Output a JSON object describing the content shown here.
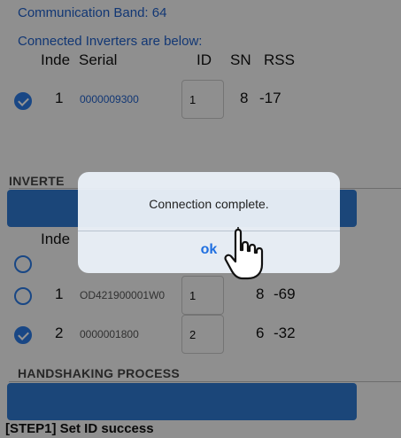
{
  "header": {
    "band_label": "Communication Band:",
    "band_value": "64",
    "connected_title": "Connected Inverters are below:"
  },
  "table_headers": {
    "index": "Inde",
    "serial": "Serial",
    "id": "ID",
    "sn": "SN",
    "rss": "RSS"
  },
  "connected_rows": [
    {
      "index": "1",
      "serial": "0000009300",
      "id": "1",
      "sn": "8",
      "rss": "-17",
      "checked": true
    }
  ],
  "inverter_section": {
    "title": "INVERTE",
    "index_header": "Inde",
    "rows": [
      {
        "index": "",
        "serial": "",
        "id": "",
        "sn": "",
        "rss": "",
        "checked": false
      },
      {
        "index": "1",
        "serial": "OD421900001W0",
        "id": "1",
        "sn": "8",
        "rss": "-69",
        "checked": false
      },
      {
        "index": "2",
        "serial": "0000001800",
        "id": "2",
        "sn": "6",
        "rss": "-32",
        "checked": true
      }
    ]
  },
  "handshaking": {
    "title": "HANDSHAKING PROCESS"
  },
  "status": {
    "step_text": "[STEP1] Set ID success"
  },
  "dialog": {
    "message": "Connection complete.",
    "ok_label": "ok"
  },
  "colors": {
    "accent": "#2f79d1",
    "link_blue": "#1f5fc9"
  },
  "icons": {
    "pointer": "hand-pointer-icon",
    "check": "checkmark-icon"
  }
}
